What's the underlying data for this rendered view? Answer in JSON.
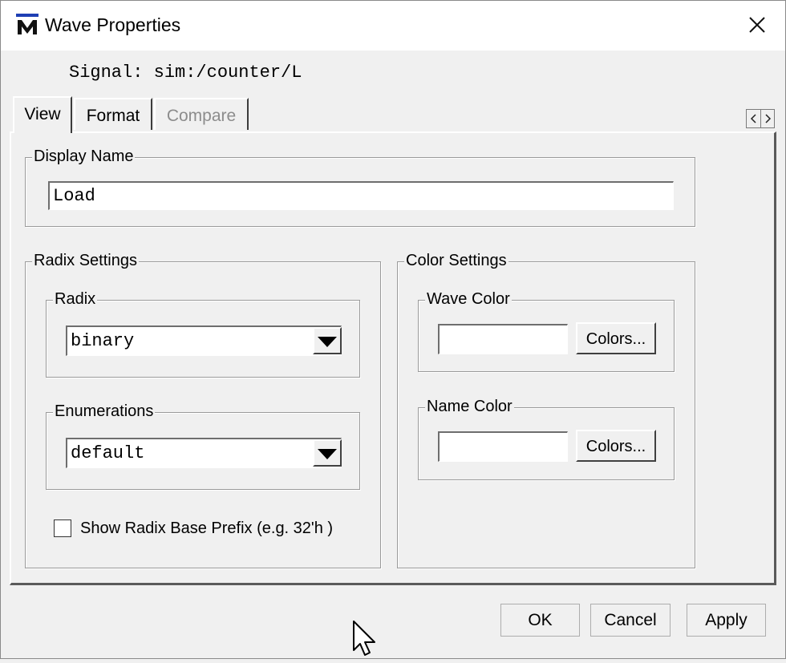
{
  "window": {
    "title": "Wave Properties"
  },
  "signal": {
    "label": "Signal:",
    "value": "sim:/counter/L"
  },
  "tabs": [
    {
      "label": "View",
      "active": true
    },
    {
      "label": "Format",
      "active": false
    },
    {
      "label": "Compare",
      "active": false,
      "disabled": true
    }
  ],
  "display_name": {
    "legend": "Display Name",
    "value": "Load"
  },
  "radix_settings": {
    "legend": "Radix Settings",
    "radix": {
      "legend": "Radix",
      "value": "binary"
    },
    "enumerations": {
      "legend": "Enumerations",
      "value": "default"
    },
    "show_prefix": {
      "label": "Show Radix Base Prefix (e.g. 32'h )",
      "checked": false
    }
  },
  "color_settings": {
    "legend": "Color Settings",
    "wave_color": {
      "legend": "Wave Color",
      "value": "",
      "button": "Colors..."
    },
    "name_color": {
      "legend": "Name Color",
      "value": "",
      "button": "Colors..."
    }
  },
  "footer": {
    "ok": "OK",
    "cancel": "Cancel",
    "apply": "Apply"
  },
  "icons": {
    "app": "modelsim-logo-icon",
    "close": "close-icon",
    "dropdown": "dropdown-arrow-icon"
  }
}
